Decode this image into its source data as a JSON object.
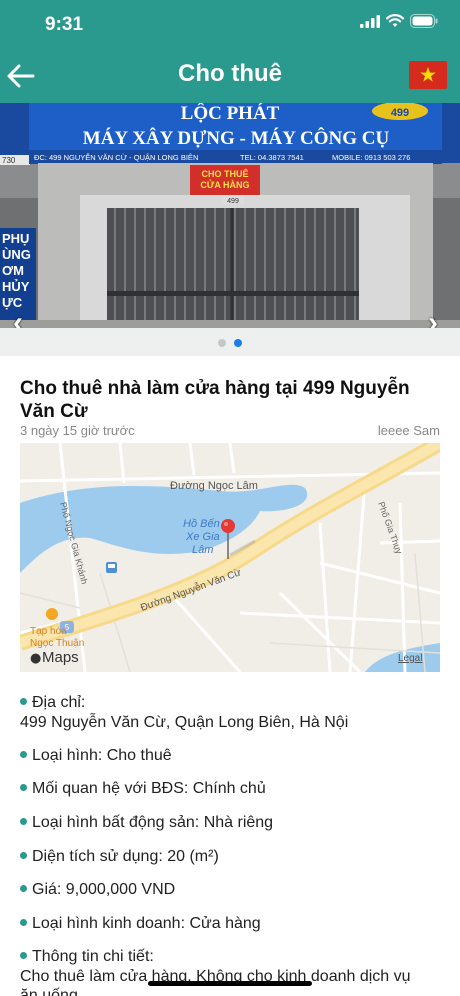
{
  "status": {
    "time": "9:31"
  },
  "header": {
    "title": "Cho thuê"
  },
  "banner": {
    "shop_name": "LỘC PHÁT",
    "shop_number": "499",
    "headline": "MÁY XÂY DỰNG - MÁY CÔNG CỤ",
    "address": "ĐC: 499 NGUYỄN VĂN CỪ - QUẬN LONG BIÊN",
    "tel": "TEL: 04.3873 7541",
    "mobile": "MOBILE: 0913 503 276",
    "sign_line1": "CHO THUÊ",
    "sign_line2": "CỬA HÀNG",
    "door_number": "499",
    "left_sign_top": "730",
    "left_sign_lines": [
      "PHỤ",
      "ÙNG",
      "ƠM",
      "HỦY",
      "ỰC"
    ]
  },
  "carousel": {
    "pages": 2,
    "current": 2
  },
  "listing": {
    "title": "Cho thuê nhà làm cửa hàng tại 499 Nguyễn Văn Cừ",
    "time_ago": "3 ngày 15 giờ trước",
    "author": "leeee Sam"
  },
  "map": {
    "labels": {
      "ngoc_lam": "Đường Ngọc Lâm",
      "ben_xe_1": "Hồ Bến",
      "ben_xe_2": "Xe Gia",
      "ben_xe_3": "Lâm",
      "nvc": "Đường Nguyễn Văn Cừ",
      "ngoc_khanh": "Phố Ngọc Gia Khánh",
      "gia_thuy": "Phố Gia Thụy",
      "tap_hoa_1": "Tạp hóa",
      "tap_hoa_2": "Ngọc Thuận",
      "maps": "Maps",
      "legal": "Legal",
      "shield": "5"
    }
  },
  "details": [
    {
      "label": "Địa chỉ:",
      "value": "499 Nguyễn Văn Cừ, Quận Long Biên, Hà Nội"
    },
    {
      "label": "Loại hình: Cho thuê"
    },
    {
      "label": "Mối quan hệ với BĐS: Chính chủ"
    },
    {
      "label": "Loại hình bất động sản: Nhà riêng"
    },
    {
      "label": "Diện tích sử dụng: 20 (m²)"
    },
    {
      "label": "Giá: 9,000,000 VND"
    },
    {
      "label": "Loại hình kinh doanh: Cửa hàng"
    },
    {
      "label": "Thông tin chi tiết:",
      "value": "Cho thuê làm cửa hàng. Không cho kinh doanh dịch vụ",
      "value2": "ăn uống"
    }
  ],
  "colors": {
    "header": "#2a9a8f",
    "bullet": "#2a9a8f",
    "flag_red": "#d52b1e",
    "flag_star": "#ffde00"
  }
}
